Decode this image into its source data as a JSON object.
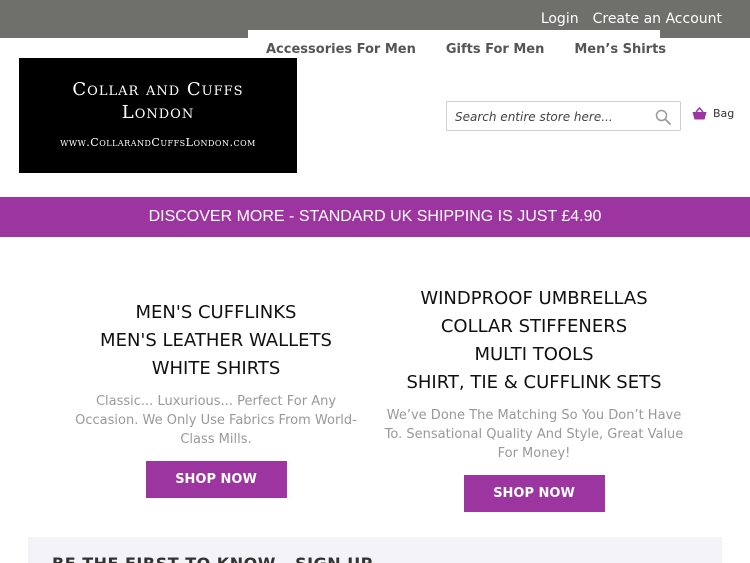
{
  "header": {
    "account_links": {
      "login": "Login",
      "create_account": "Create an Account"
    },
    "nav": [
      "Accessories For Men",
      "Gifts For Men",
      "Men’s Shirts"
    ]
  },
  "logo": {
    "line1": "Collar and Cuffs",
    "line2": "London",
    "line3": "www.CollarandCuffsLondon.com"
  },
  "search": {
    "placeholder": "Search entire store here...",
    "icon": "search-icon"
  },
  "bag": {
    "label": "Bag",
    "icon": "shopping-basket-icon"
  },
  "promo": {
    "text": "DISCOVER MORE - STANDARD UK SHIPPING IS JUST £4.90"
  },
  "promos": [
    {
      "headings": [
        "MEN'S CUFFLINKS",
        "MEN'S LEATHER WALLETS",
        "WHITE SHIRTS"
      ],
      "description": "Classic... Luxurious... Perfect For Any Occasion. We Only Use Fabrics From World-Class Mills.",
      "button": "SHOP NOW"
    },
    {
      "headings": [
        "WINDPROOF UMBRELLAS",
        "COLLAR STIFFENERS",
        "MULTI TOOLS",
        "SHIRT, TIE & CUFFLINK SETS"
      ],
      "description": "We’ve Done The Matching So You Don’t Have To. Sensational Quality And Style, Great Value For Money!",
      "button": "SHOP NOW"
    }
  ],
  "signup": {
    "title": "BE THE FIRST TO KNOW - SIGN UP"
  },
  "colors": {
    "topbar": "#6f6f6c",
    "accent": "#9c35a0"
  }
}
